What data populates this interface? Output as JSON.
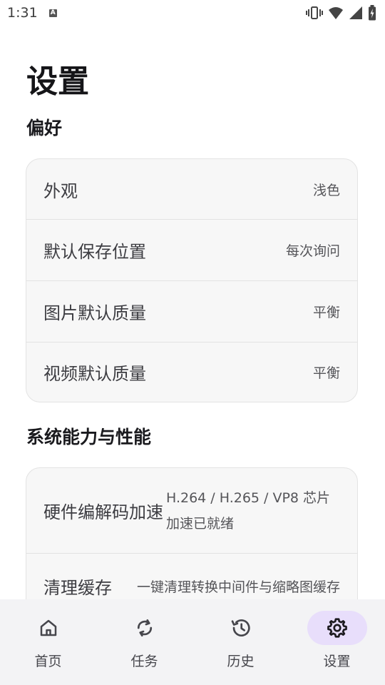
{
  "status_bar": {
    "time": "1:31",
    "notification_letter": "A"
  },
  "page": {
    "title": "设置"
  },
  "sections": [
    {
      "title": "偏好",
      "rows": [
        {
          "label": "外观",
          "value": "浅色"
        },
        {
          "label": "默认保存位置",
          "value": "每次询问"
        },
        {
          "label": "图片默认质量",
          "value": "平衡"
        },
        {
          "label": "视频默认质量",
          "value": "平衡"
        }
      ]
    },
    {
      "title": "系统能力与性能",
      "rows": [
        {
          "label": "硬件编解码加速",
          "value": "H.264 / H.265 / VP8 芯片加速已就绪"
        },
        {
          "label": "清理缓存",
          "value": "一键清理转换中间件与缩略图缓存"
        }
      ]
    }
  ],
  "bottom_nav": {
    "active": "设置",
    "items": [
      {
        "label": "首页",
        "icon": "home-icon"
      },
      {
        "label": "任务",
        "icon": "sync-icon"
      },
      {
        "label": "历史",
        "icon": "history-icon"
      },
      {
        "label": "设置",
        "icon": "gear-icon"
      }
    ]
  },
  "colors": {
    "accent_pill": "#e8defb",
    "nav_background": "#f3f3f5",
    "card_background": "#f7f7f7"
  }
}
